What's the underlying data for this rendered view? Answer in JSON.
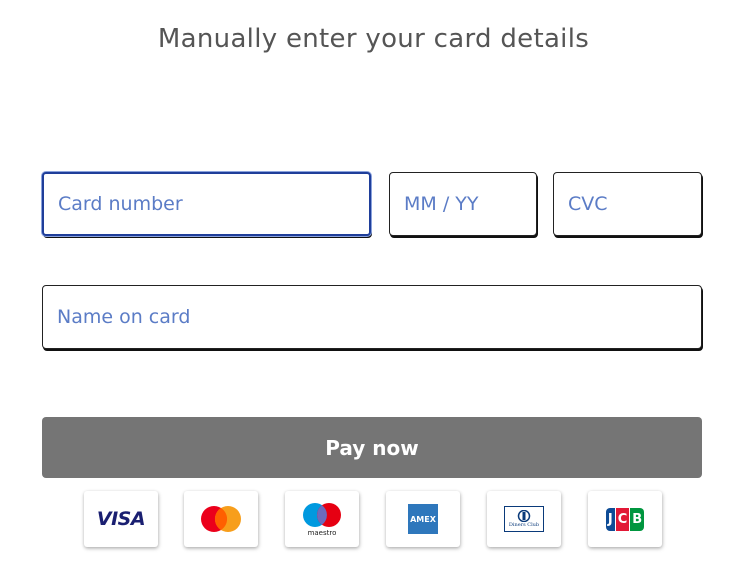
{
  "heading": "Manually enter your card details",
  "form": {
    "card_number_placeholder": "Card number",
    "expiry_placeholder": "MM / YY",
    "cvc_placeholder": "CVC",
    "name_placeholder": "Name on card",
    "pay_label": "Pay now"
  },
  "card_logos": [
    {
      "name": "visa-icon",
      "text": "VISA"
    },
    {
      "name": "mastercard-icon"
    },
    {
      "name": "maestro-icon",
      "text": "maestro"
    },
    {
      "name": "amex-icon",
      "text": "AMEX"
    },
    {
      "name": "diners-club-icon",
      "text": "Diners Club"
    },
    {
      "name": "jcb-icon",
      "text": "JCB"
    }
  ],
  "colors": {
    "accent_focus": "#1f3e9a",
    "placeholder": "#5b7cc6",
    "button_disabled": "#757575"
  }
}
